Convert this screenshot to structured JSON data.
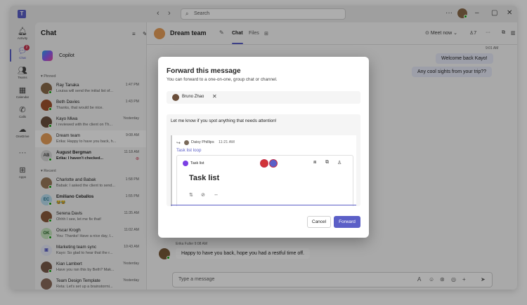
{
  "titlebar": {
    "search_placeholder": "Search"
  },
  "rail": {
    "items": [
      {
        "label": "Activity",
        "icon": "bell-icon"
      },
      {
        "label": "Chat",
        "icon": "chat-icon",
        "badge": "2"
      },
      {
        "label": "Teams",
        "icon": "teams-icon"
      },
      {
        "label": "Calendar",
        "icon": "calendar-icon"
      },
      {
        "label": "Calls",
        "icon": "phone-icon"
      },
      {
        "label": "OneDrive",
        "icon": "cloud-icon"
      },
      {
        "label": "Apps",
        "icon": "apps-icon"
      }
    ]
  },
  "chatlist": {
    "title": "Chat",
    "copilot": "Copilot",
    "pinned_label": "Pinned",
    "recent_label": "Recent",
    "pinned": [
      {
        "name": "Ray Tanaka",
        "preview": "Louisa will send the initial list of...",
        "time": "1:47 PM",
        "initials": "",
        "color": "#8a6a4a"
      },
      {
        "name": "Beth Davies",
        "preview": "Thanks, that would be nice.",
        "time": "1:43 PM",
        "initials": "",
        "color": "#a0522d"
      },
      {
        "name": "Kayo Miwa",
        "preview": "I reviewed with the client on Th...",
        "time": "Yesterday",
        "initials": "",
        "color": "#6b4e3d"
      },
      {
        "name": "Dream team",
        "preview": "Erika: Happy to have you back, h...",
        "time": "9:08 AM",
        "initials": "",
        "color": "#e8a05a"
      },
      {
        "name": "August Bergman",
        "preview": "Erika: I haven't checked...",
        "time": "11:18 AM",
        "initials": "AB",
        "color": "#d0d0d0"
      }
    ],
    "recent": [
      {
        "name": "Charlotte and Babak",
        "preview": "Babak: I asked the client to send...",
        "time": "1:58 PM",
        "initials": "",
        "color": "#9a7a5a"
      },
      {
        "name": "Emiliano Ceballos",
        "preview": "😂😂",
        "time": "1:55 PM",
        "initials": "EC",
        "color": "#7ac0d8"
      },
      {
        "name": "Serena Davis",
        "preview": "Ohhh I see, let me fix that!",
        "time": "11:35 AM",
        "initials": "",
        "color": "#8b5a3c"
      },
      {
        "name": "Oscar Krogh",
        "preview": "You: Thanks! Have a nice day, I...",
        "time": "11:02 AM",
        "initials": "OK",
        "color": "#9ad29a"
      },
      {
        "name": "Marketing team sync",
        "preview": "Kayo: So glad to hear that the r...",
        "time": "10:43 AM",
        "initials": "",
        "color": "#e8ebfa"
      },
      {
        "name": "Kian Lambert",
        "preview": "Have you ran this by Beth? Mak...",
        "time": "Yesterday",
        "initials": "",
        "color": "#7a5a4a"
      },
      {
        "name": "Team Design Template",
        "preview": "Reta: Let's set up a brainstormi...",
        "time": "Yesterday",
        "initials": "",
        "color": "#8a6a5a"
      }
    ]
  },
  "header": {
    "title": "Dream team",
    "tab_chat": "Chat",
    "tab_files": "Files",
    "meet_now": "Meet now",
    "participants": "7"
  },
  "messages": {
    "time_top": "9:01 AM",
    "out1": "Welcome back Kayo!",
    "out2": "Any cool sights from your trip??",
    "meta_bottom": "Erika Fuller  9:08 AM",
    "in1": "Happy to have you back, hope you had a restful time off."
  },
  "composer": {
    "placeholder": "Type a message"
  },
  "dialog": {
    "title": "Forward this message",
    "subtitle": "You can forward to a one-on-one, group chat or channel.",
    "recipient": "Bruno Zhao",
    "message_text": "Let me know if you spot anything that needs attention!",
    "fwd_sender": "Daisy Phillips",
    "fwd_time": "11:21 AM",
    "fwd_link": "Task list loop",
    "loop_label": "Task list",
    "loop_title": "Task list",
    "cancel": "Cancel",
    "forward": "Forward"
  },
  "colors": {
    "accent": "#5b5fc7",
    "presence_available": "#13a10e",
    "badge": "#c4314b"
  }
}
